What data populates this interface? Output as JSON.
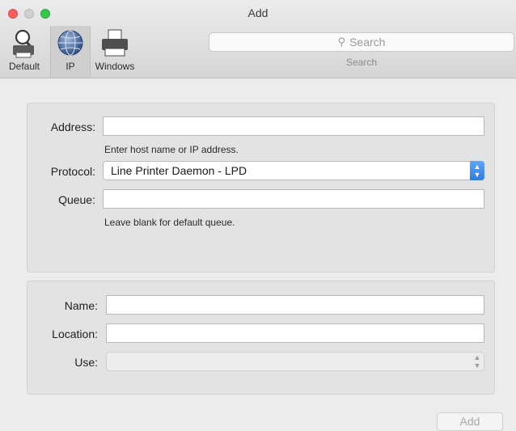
{
  "window": {
    "title": "Add",
    "colors": {
      "close": "#fc605c",
      "minimize": "#d0d0d0",
      "zoom": "#34c84a",
      "accent": "#2e7de6"
    }
  },
  "toolbar": {
    "items": [
      {
        "label": "Default",
        "icon": "default-printer-icon"
      },
      {
        "label": "IP",
        "icon": "globe-icon",
        "selected": true
      },
      {
        "label": "Windows",
        "icon": "windows-printer-icon"
      }
    ],
    "search": {
      "placeholder": "Search",
      "caption": "Search"
    }
  },
  "form": {
    "address": {
      "label": "Address:",
      "value": "",
      "hint": "Enter host name or IP address."
    },
    "protocol": {
      "label": "Protocol:",
      "value": "Line Printer Daemon - LPD"
    },
    "queue": {
      "label": "Queue:",
      "value": "",
      "hint": "Leave blank for default queue."
    },
    "name": {
      "label": "Name:",
      "value": ""
    },
    "location": {
      "label": "Location:",
      "value": ""
    },
    "use": {
      "label": "Use:",
      "value": ""
    }
  },
  "footer": {
    "add_label": "Add"
  }
}
